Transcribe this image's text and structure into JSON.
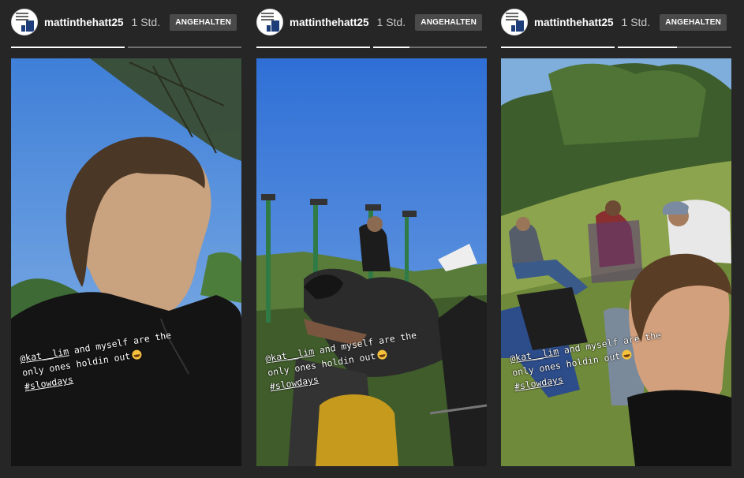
{
  "stories": [
    {
      "username": "mattinthehatt25",
      "time": "1 Std.",
      "status_badge": "ANGEHALTEN",
      "progress": [
        1.0,
        0.0
      ],
      "caption": {
        "mention": "@kat__lim",
        "line1_rest": " and myself are the",
        "line2": "only ones holdin out",
        "hashtag": "#slowdays"
      }
    },
    {
      "username": "mattinthehatt25",
      "time": "1 Std.",
      "status_badge": "ANGEHALTEN",
      "progress": [
        1.0,
        0.32
      ],
      "caption": {
        "mention": "@kat__lim",
        "line1_rest": " and myself are the",
        "line2": "only ones holdin out",
        "hashtag": "#slowdays"
      }
    },
    {
      "username": "mattinthehatt25",
      "time": "1 Std.",
      "status_badge": "ANGEHALTEN",
      "progress": [
        1.0,
        0.52
      ],
      "caption": {
        "mention": "@kat__lim",
        "line1_rest": " and myself are the",
        "line2": "only ones holdin out",
        "hashtag": "#slowdays"
      }
    }
  ],
  "icons": {
    "avatar": "profile-avatar-icon",
    "emoji": "laughing-tears-emoji-icon"
  },
  "colors": {
    "background": "#262626",
    "badge_bg": "#4a4a4a",
    "progress_fill": "#ffffff"
  }
}
